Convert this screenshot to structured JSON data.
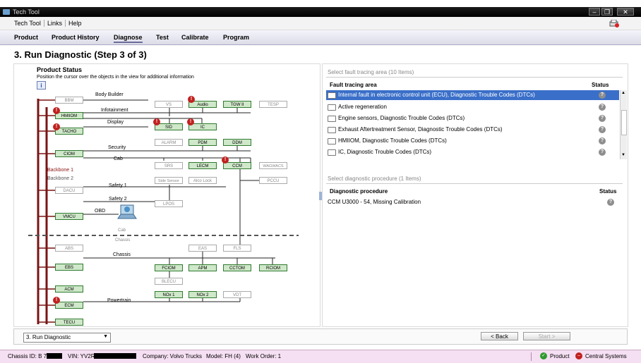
{
  "window": {
    "title": "Tech Tool"
  },
  "menu": {
    "items": [
      "Tech Tool",
      "Links",
      "Help"
    ]
  },
  "tabs": [
    "Product",
    "Product History",
    "Diagnose",
    "Test",
    "Calibrate",
    "Program"
  ],
  "active_tab": "Diagnose",
  "page": {
    "step_title": "3. Run Diagnostic (Step 3 of 3)"
  },
  "product_status": {
    "title": "Product Status",
    "hint": "Position the cursor over the objects in the view for additional information",
    "groups": {
      "body_builder": "Body Builder",
      "infotainment": "Infotainment",
      "display": "Display",
      "security": "Security",
      "cab": "Cab",
      "safety1": "Safety 1",
      "safety2": "Safety 2",
      "obd": "OBD",
      "chassis": "Chassis",
      "powertrain": "Powertrain",
      "backbone1": "Backbone 1",
      "backbone2": "Backbone 2",
      "cab_small": "Cab",
      "chassis_small": "Chassis"
    },
    "ecus": {
      "bbm": "BBM",
      "hmiiom": "HMIIOM",
      "tacho": "TACHO",
      "ciom": "CIOM",
      "dacu": "DACU",
      "vmcu": "VMCU",
      "abs": "ABS",
      "ebs": "EBS",
      "acm": "ACM",
      "ecm": "ECM",
      "tecu": "TECU",
      "vs": "VS",
      "audio": "Audio",
      "tgw": "TGW II",
      "tesp": "TESP",
      "sid": "SID",
      "ic": "IC",
      "alarm": "ALARM",
      "pdm": "PDM",
      "ddm": "DDM",
      "srs": "SRS",
      "lecm": "LECM",
      "ccm": "CCM",
      "wagwacs": "WAGWACS",
      "sidesensor": "Side Sensor",
      "alcolock": "Alco Lock",
      "pccu": "PCCU",
      "lpos": "LPOS",
      "eas": "EAS",
      "fls": "FLS",
      "fciom": "FCIOM",
      "apm": "APM",
      "cctom": "CCTOM",
      "rciom": "RCIOM",
      "blecu": "BLECU",
      "nox1": "NOx 1",
      "nox2": "NOx 2",
      "vdt": "VDT"
    },
    "badge": "!"
  },
  "fault_area": {
    "section_title": "Select fault tracing area (10 Items)",
    "col_area": "Fault tracing area",
    "col_status": "Status",
    "rows": [
      "Internal fault in electronic control unit (ECU), Diagnostic Trouble Codes (DTCs)",
      "Active regeneration",
      "Engine sensors, Diagnostic Trouble Codes (DTCs)",
      "Exhaust Aftertreatment Sensor, Diagnostic Trouble Codes (DTCs)",
      "HMIIOM, Diagnostic Trouble Codes (DTCs)",
      "IC, Diagnostic Trouble Codes (DTCs)"
    ],
    "status_glyph": "?"
  },
  "procedure": {
    "section_title": "Select diagnostic procedure (1 Items)",
    "col_proc": "Diagnostic procedure",
    "col_status": "Status",
    "rows": [
      "CCM U3000 - 54, Missing Calibration"
    ],
    "status_glyph": "?"
  },
  "bottom": {
    "step_select": "3. Run Diagnostic",
    "back": "< Back",
    "start": "Start >"
  },
  "status": {
    "chassis": "Chassis ID: B 7",
    "vin": "VIN: YV2R",
    "company": "Company: Volvo Trucks",
    "model": "Model: FH (4)",
    "work_order": "Work Order: 1",
    "product": "Product",
    "central": "Central Systems"
  },
  "colors": {
    "selected_row": "#3a6fc9",
    "backbone": "#7a1414",
    "ecu_active": "#cfe8c9",
    "fault_badge": "#c0211f",
    "statusbar": "#f5dff2"
  }
}
